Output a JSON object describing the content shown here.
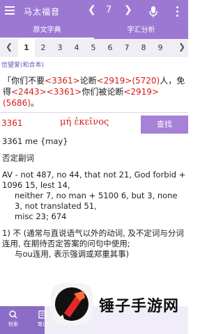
{
  "header": {
    "book_title": "马太福音",
    "chapter": "7",
    "prev_glyph": "❮",
    "next_glyph": "❯",
    "icons": [
      "menu-icon",
      "microphone-icon",
      "more-vert-icon"
    ]
  },
  "tabs": [
    {
      "label": "原文字典",
      "active": true
    },
    {
      "label": "字汇分析",
      "active": false
    }
  ],
  "verse_strip": {
    "left_arrow": "❮",
    "right_arrow": "❯",
    "items": [
      "1",
      "2",
      "3",
      "4",
      "5",
      "6",
      "7",
      "8",
      "9"
    ],
    "active": "1"
  },
  "version_label": "信望爱(和合本)",
  "verse": {
    "segments": [
      {
        "t": "「你们不要",
        "red": false
      },
      {
        "t": "<3361>",
        "red": true
      },
      {
        "t": "论断",
        "red": false
      },
      {
        "t": "<2919>(5720)",
        "red": true
      },
      {
        "t": "人，免得",
        "red": false
      },
      {
        "t": "<2443><3361>",
        "red": true
      },
      {
        "t": "你们被论断",
        "red": false
      },
      {
        "t": "<2919>(5686)",
        "red": true
      },
      {
        "t": "。",
        "red": false
      }
    ]
  },
  "strong": {
    "number": "3361",
    "greek": "μή ἐκεῖνος",
    "search_label": "查找"
  },
  "definition": {
    "line1": "3361 me {may}",
    "line2": "否定副词",
    "line3": "AV - not 487, no 44, that not 21, God forbid + 1096 15, lest 14,",
    "line4": "neither 7, no man + 5100 6, but 3, none 3, not translated 51,",
    "line5": "misc 23; 674",
    "line6": "1) 不 (通常与直说语气以外的动词, 及不定词与分词连用, 在期待否定答案的问句中使用;",
    "line7": "与ou连用, 表示强调或郑重其事)"
  },
  "bottom_bar": [
    {
      "label": "检索",
      "icon": "search-icon"
    },
    {
      "label": "笔记",
      "icon": "note-icon"
    }
  ],
  "watermark": {
    "text": "锤子手游网",
    "logo": "hammer-logo"
  }
}
